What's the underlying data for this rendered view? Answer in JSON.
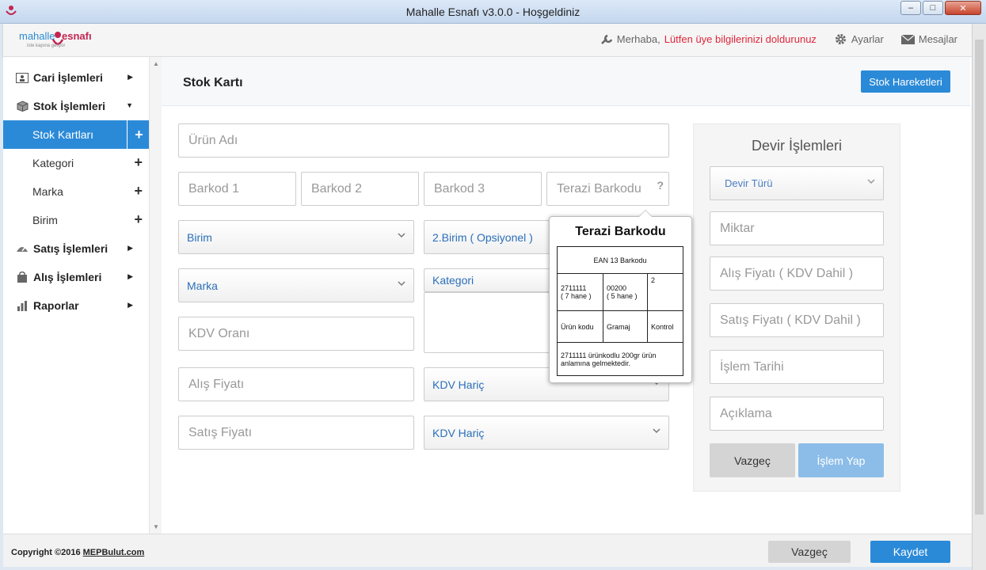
{
  "window": {
    "title": "Mahalle Esnafı v3.0.0 - Hoşgeldiniz",
    "minimize": "‒",
    "maximize": "□",
    "close": "✕"
  },
  "header": {
    "logo_part1": "mahalle",
    "logo_part2": "esnafı",
    "logo_tagline": "iste kapına geliyor",
    "greeting_prefix": "Merhaba,",
    "greeting_warning": "Lütfen üye bilgilerinizi doldurunuz",
    "settings_label": "Ayarlar",
    "messages_label": "Mesajlar",
    "accent_color": "#2b8ad8",
    "warning_color": "#e0263a"
  },
  "sidebar": {
    "items": [
      {
        "label": "Cari İşlemleri",
        "icon": "contact-card-icon",
        "arrow": "▶"
      },
      {
        "label": "Stok İşlemleri",
        "icon": "box-icon",
        "arrow": "▼"
      }
    ],
    "sub_items": [
      {
        "label": "Stok Kartları",
        "plus": "+"
      },
      {
        "label": "Kategori",
        "plus": "+"
      },
      {
        "label": "Marka",
        "plus": "+"
      },
      {
        "label": "Birim",
        "plus": "+"
      }
    ],
    "more_items": [
      {
        "label": "Satış İşlemleri",
        "icon": "sales-icon",
        "arrow": "▶"
      },
      {
        "label": "Alış İşlemleri",
        "icon": "bag-icon",
        "arrow": "▶"
      },
      {
        "label": "Raporlar",
        "icon": "bar-chart-icon",
        "arrow": "▶"
      }
    ]
  },
  "page": {
    "title": "Stok Kartı",
    "stock_movements_button": "Stok Hareketleri"
  },
  "form": {
    "product_name": "Ürün Adı",
    "barcode1": "Barkod 1",
    "barcode2": "Barkod 2",
    "barcode3": "Barkod 3",
    "scale_barcode": "Terazi Barkodu",
    "help_mark": "?",
    "unit": "Birim",
    "unit2": "2.Birim ( Opsiyonel )",
    "brand": "Marka",
    "category": "Kategori",
    "vat_rate": "KDV Oranı",
    "purchase_price": "Alış Fiyatı",
    "purchase_vat": "KDV Hariç",
    "sale_price": "Satış Fiyatı",
    "sale_vat": "KDV Hariç"
  },
  "tooltip": {
    "title": "Terazi Barkodu",
    "table_header": "EAN 13 Barkodu",
    "code_value": "2711111",
    "code_digits": "( 7 hane )",
    "weight_value": "00200",
    "weight_digits": "( 5 hane )",
    "control_value": "2",
    "code_label": "Ürün kodu",
    "weight_label": "Gramaj",
    "control_label": "Kontrol",
    "description": "2711111 ürünkodlu 200gr ürün anlamına gelmektedir."
  },
  "devir": {
    "title": "Devir İşlemleri",
    "type": "Devir Türü",
    "quantity": "Miktar",
    "buy_price": "Alış Fiyatı ( KDV Dahil )",
    "sell_price": "Satış Fiyatı ( KDV Dahil )",
    "date": "İşlem Tarihi",
    "note": "Açıklama",
    "cancel_button": "Vazgeç",
    "submit_button": "İşlem Yap"
  },
  "footer": {
    "copyright_prefix": "Copyright ©2016",
    "copyright_link": "MEPBulut.com",
    "cancel_button": "Vazgeç",
    "save_button": "Kaydet"
  }
}
